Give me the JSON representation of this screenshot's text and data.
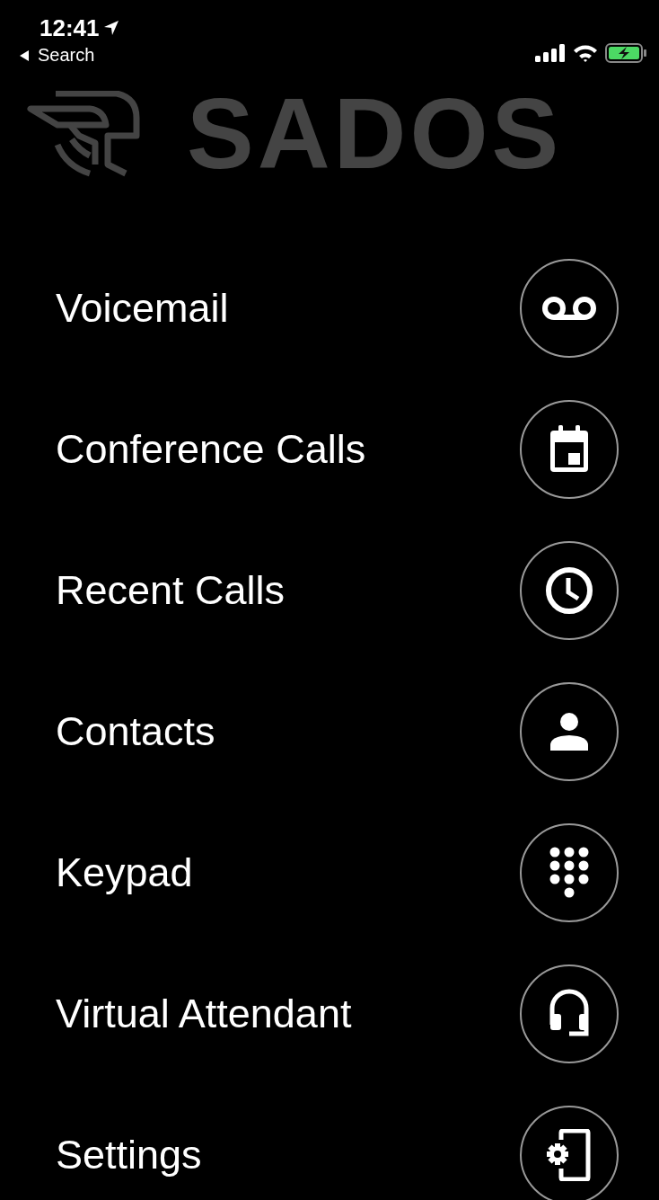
{
  "status_bar": {
    "time": "12:41",
    "back_label": "Search"
  },
  "logo": {
    "text": "SADOS"
  },
  "menu": [
    {
      "label": "Voicemail",
      "kind": "voicemail"
    },
    {
      "label": "Conference Calls",
      "kind": "calendar"
    },
    {
      "label": "Recent Calls",
      "kind": "clock"
    },
    {
      "label": "Contacts",
      "kind": "person"
    },
    {
      "label": "Keypad",
      "kind": "keypad"
    },
    {
      "label": "Virtual Attendant",
      "kind": "headset"
    },
    {
      "label": "Settings",
      "kind": "settings"
    }
  ]
}
